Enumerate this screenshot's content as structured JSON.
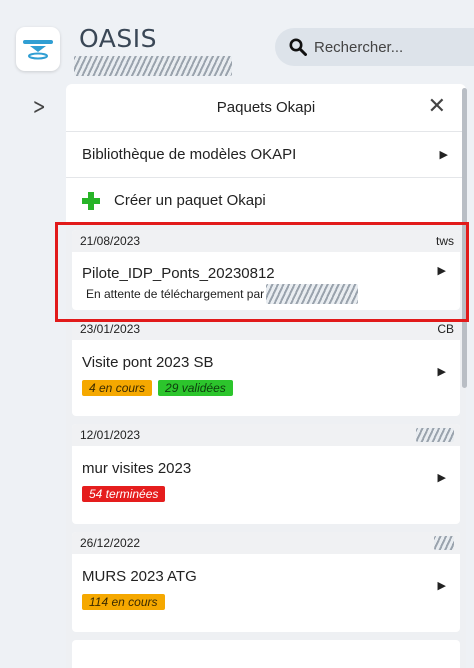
{
  "app": {
    "title": "OASIS"
  },
  "search": {
    "placeholder": "Rechercher..."
  },
  "panel": {
    "title": "Paquets Okapi",
    "library_label": "Bibliothèque de modèles OKAPI",
    "create_label": "Créer un paquet Okapi"
  },
  "packages": [
    {
      "date": "21/08/2023",
      "author": "tws",
      "name": "Pilote_IDP_Ponts_20230812",
      "status": "En attente de téléchargement par",
      "badges": []
    },
    {
      "date": "23/01/2023",
      "author": "CB",
      "name": "Visite pont 2023 SB",
      "status": "",
      "badges": [
        {
          "label": "4 en cours",
          "color": "#f5a800"
        },
        {
          "label": "29 validées",
          "color": "#2cc52c"
        }
      ]
    },
    {
      "date": "12/01/2023",
      "author": "",
      "name": "mur visites 2023",
      "status": "",
      "badges": [
        {
          "label": "54 terminées",
          "color": "#e51d1d"
        }
      ]
    },
    {
      "date": "26/12/2022",
      "author": "",
      "name": "MURS 2023 ATG",
      "status": "",
      "badges": [
        {
          "label": "114 en cours",
          "color": "#f5a800"
        }
      ]
    }
  ],
  "icons": {
    "logo": "oasis-logo-icon",
    "search": "search-icon",
    "expand": "chevron-right-icon",
    "close": "close-icon",
    "add": "plus-icon",
    "arrow": "caret-right-icon"
  }
}
